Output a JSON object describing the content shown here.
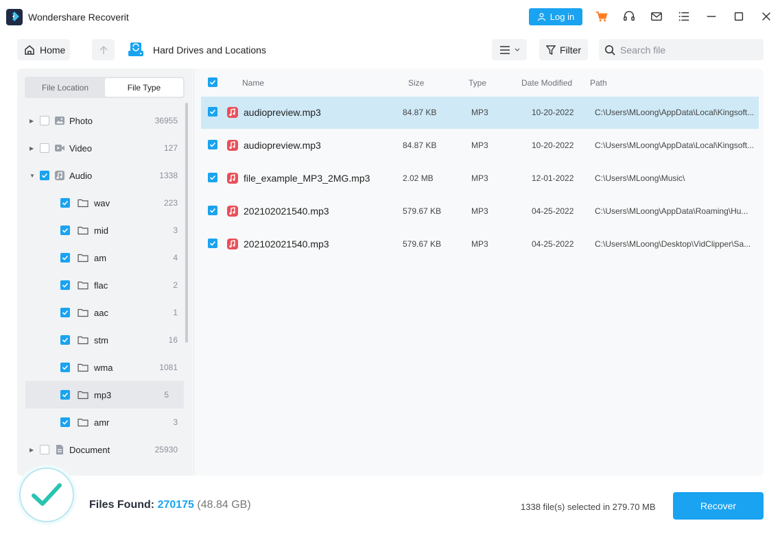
{
  "app": {
    "title": "Wondershare Recoverit"
  },
  "titlebar": {
    "login_label": "Log in",
    "icons": [
      "cart-icon",
      "headset-icon",
      "mail-icon",
      "menu-icon",
      "minimize-icon",
      "maximize-icon",
      "close-icon"
    ]
  },
  "toolbar": {
    "home_label": "Home",
    "location_title": "Hard Drives and Locations",
    "filter_label": "Filter",
    "search_placeholder": "Search file"
  },
  "left_panel": {
    "tabs": [
      {
        "label": "File Location",
        "active": false
      },
      {
        "label": "File Type",
        "active": true
      }
    ],
    "tree": [
      {
        "label": "Photo",
        "count": "36955",
        "checked": false,
        "level": 0,
        "expanded": false,
        "icon": "photo-icon"
      },
      {
        "label": "Video",
        "count": "127",
        "checked": false,
        "level": 0,
        "expanded": false,
        "icon": "video-icon"
      },
      {
        "label": "Audio",
        "count": "1338",
        "checked": true,
        "level": 0,
        "expanded": true,
        "icon": "audio-icon"
      },
      {
        "label": "wav",
        "count": "223",
        "checked": true,
        "level": 1,
        "icon": "folder-icon"
      },
      {
        "label": "mid",
        "count": "3",
        "checked": true,
        "level": 1,
        "icon": "folder-icon"
      },
      {
        "label": "am",
        "count": "4",
        "checked": true,
        "level": 1,
        "icon": "folder-icon"
      },
      {
        "label": "flac",
        "count": "2",
        "checked": true,
        "level": 1,
        "icon": "folder-icon"
      },
      {
        "label": "aac",
        "count": "1",
        "checked": true,
        "level": 1,
        "icon": "folder-icon"
      },
      {
        "label": "stm",
        "count": "16",
        "checked": true,
        "level": 1,
        "icon": "folder-icon"
      },
      {
        "label": "wma",
        "count": "1081",
        "checked": true,
        "level": 1,
        "icon": "folder-icon"
      },
      {
        "label": "mp3",
        "count": "5",
        "checked": true,
        "level": 1,
        "icon": "folder-icon",
        "selected": true
      },
      {
        "label": "amr",
        "count": "3",
        "checked": true,
        "level": 1,
        "icon": "folder-icon"
      },
      {
        "label": "Document",
        "count": "25930",
        "checked": false,
        "level": 0,
        "expanded": false,
        "icon": "document-icon"
      }
    ]
  },
  "table": {
    "headers": {
      "name": "Name",
      "size": "Size",
      "type": "Type",
      "date": "Date Modified",
      "path": "Path"
    },
    "rows": [
      {
        "name": "audiopreview.mp3",
        "size": "84.87 KB",
        "type": "MP3",
        "date": "10-20-2022",
        "path": "C:\\Users\\MLoong\\AppData\\Local\\Kingsoft...",
        "selected": true
      },
      {
        "name": "audiopreview.mp3",
        "size": "84.87 KB",
        "type": "MP3",
        "date": "10-20-2022",
        "path": "C:\\Users\\MLoong\\AppData\\Local\\Kingsoft...",
        "selected": false
      },
      {
        "name": "file_example_MP3_2MG.mp3",
        "size": "2.02 MB",
        "type": "MP3",
        "date": "12-01-2022",
        "path": "C:\\Users\\MLoong\\Music\\",
        "selected": false
      },
      {
        "name": "202102021540.mp3",
        "size": "579.67 KB",
        "type": "MP3",
        "date": "04-25-2022",
        "path": "C:\\Users\\MLoong\\AppData\\Roaming\\Hu...",
        "selected": false
      },
      {
        "name": "202102021540.mp3",
        "size": "579.67 KB",
        "type": "MP3",
        "date": "04-25-2022",
        "path": "C:\\Users\\MLoong\\Desktop\\VidClipper\\Sa...",
        "selected": false
      }
    ]
  },
  "footer": {
    "files_found_label": "Files Found:",
    "files_found_count": "270175",
    "files_found_size": "(48.84 GB)",
    "selected_info": "1338 file(s) selected in 279.70 MB",
    "recover_label": "Recover"
  },
  "colors": {
    "accent": "#1aa3f0",
    "audio": "#e9505a",
    "check_ring": "#2ac4b0"
  }
}
